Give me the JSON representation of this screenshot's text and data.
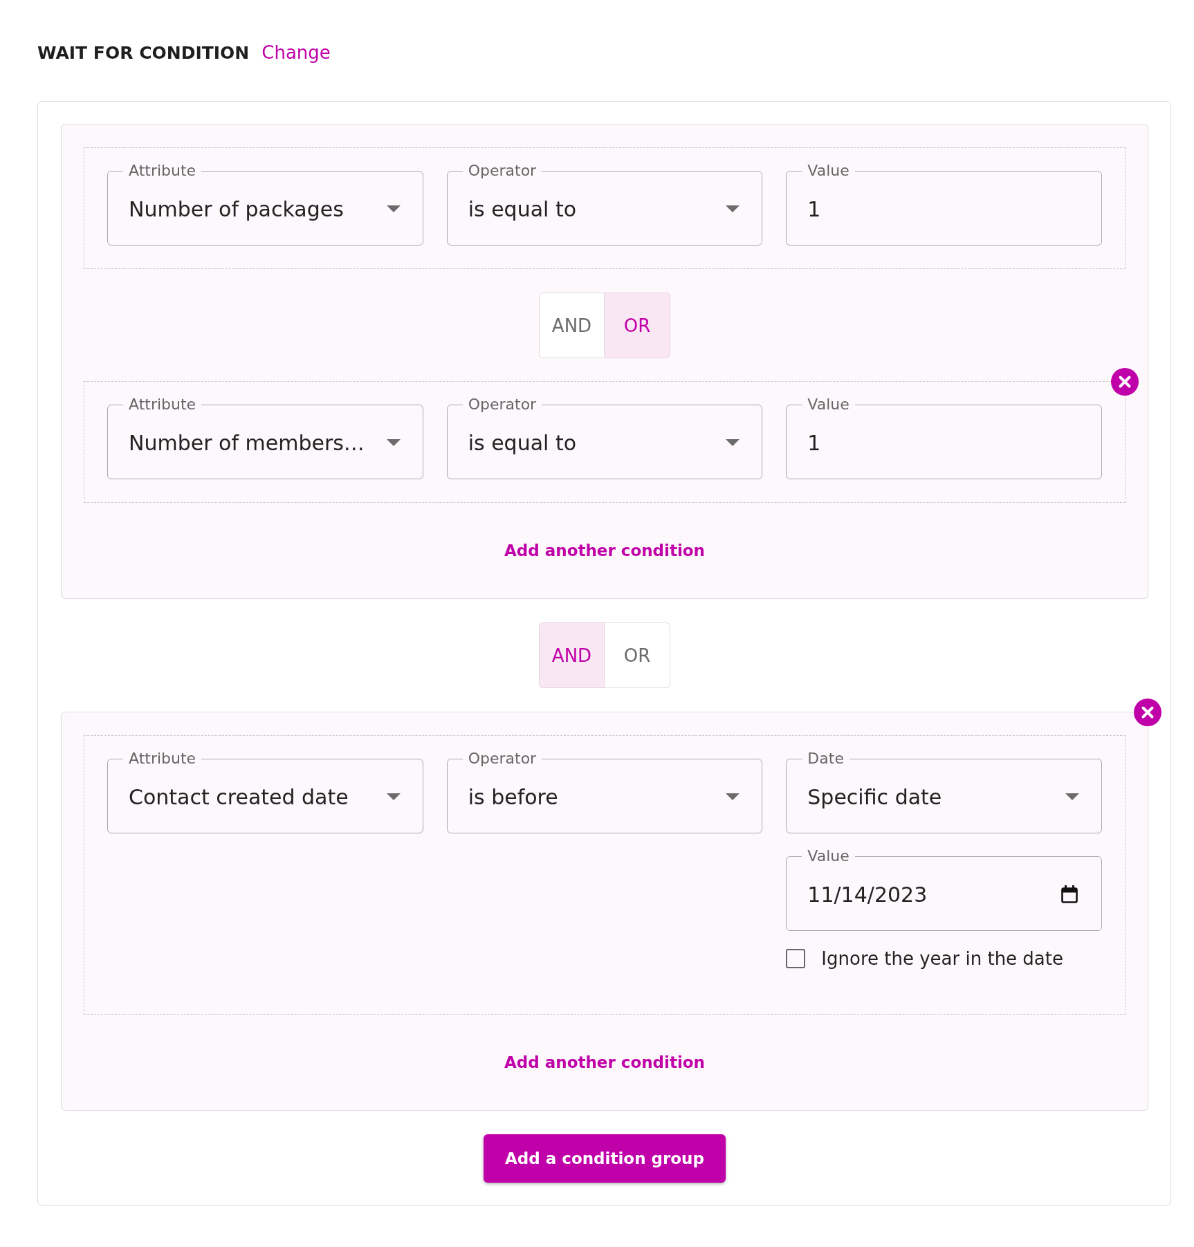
{
  "header": {
    "title": "WAIT FOR CONDITION",
    "change_link": "Change"
  },
  "groups": [
    {
      "removable": false,
      "conditions": [
        {
          "removable": false,
          "fields": [
            {
              "kind": "select",
              "label": "Attribute",
              "value": "Number of packages"
            },
            {
              "kind": "select",
              "label": "Operator",
              "value": "is equal to"
            },
            {
              "kind": "text",
              "label": "Value",
              "value": "1"
            }
          ]
        },
        {
          "joiner": [
            {
              "label": "AND",
              "selected": false
            },
            {
              "label": "OR",
              "selected": true
            }
          ],
          "removable": true,
          "fields": [
            {
              "kind": "select",
              "label": "Attribute",
              "value": "Number of members…"
            },
            {
              "kind": "select",
              "label": "Operator",
              "value": "is equal to"
            },
            {
              "kind": "text",
              "label": "Value",
              "value": "1"
            }
          ]
        }
      ],
      "add_condition_link": "Add another condition"
    },
    {
      "joiner": [
        {
          "label": "AND",
          "selected": true
        },
        {
          "label": "OR",
          "selected": false
        }
      ],
      "removable": true,
      "conditions": [
        {
          "removable": false,
          "fields": [
            {
              "kind": "select",
              "label": "Attribute",
              "value": "Contact created date"
            },
            {
              "kind": "select",
              "label": "Operator",
              "value": "is before"
            },
            {
              "kind": "select",
              "label": "Date",
              "value": "Specific date"
            },
            {
              "kind": "date",
              "label": "Value",
              "value": "11/14/2023"
            },
            {
              "kind": "checkbox",
              "label": "Ignore the year in the date",
              "checked": false
            }
          ]
        }
      ],
      "add_condition_link": "Add another condition"
    }
  ],
  "add_group_button": "Add a condition group"
}
